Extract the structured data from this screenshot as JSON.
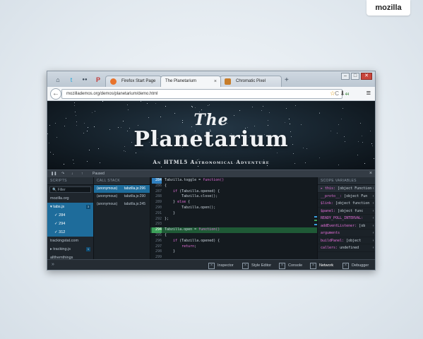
{
  "brand": "mozilla",
  "window_controls": {
    "minimize": "–",
    "maximize": "□",
    "close": "✕"
  },
  "pinned_tabs": [
    {
      "icon": "home-icon",
      "glyph": "⌂"
    },
    {
      "icon": "twitter-icon",
      "glyph": "t"
    },
    {
      "icon": "flickr-icon",
      "glyph": "●●"
    },
    {
      "icon": "pocket-icon",
      "glyph": "P"
    }
  ],
  "tabs": [
    {
      "label": "Firefox Start Page",
      "color": "#e8732c",
      "active": false
    },
    {
      "label": "The Planetarium",
      "color": "#2b3f57",
      "active": true
    },
    {
      "label": "Chromatic Pixel",
      "color": "#c77d2a",
      "active": false
    }
  ],
  "new_tab": "+",
  "nav": {
    "back": "←",
    "url": "mozillademos.org/demos/planetarium/demo.html",
    "reload": "C",
    "bookmark_star": "☆",
    "download_count": "44",
    "menu": "≡"
  },
  "hero": {
    "the": "The",
    "title": "Planetarium",
    "subtitle": "An HTML5 Astronomical Adventure"
  },
  "devtools": {
    "status": "Paused",
    "close": "×",
    "scripts": {
      "header": "Scripts",
      "filter_placeholder": "Filter",
      "items": [
        {
          "label": "mozilla.org",
          "selected": false,
          "sub": false,
          "badge": ""
        },
        {
          "label": "▾ tabs.js",
          "selected": true,
          "sub": false,
          "badge": "3"
        },
        {
          "label": "✓ 284",
          "selected": true,
          "sub": true,
          "badge": ""
        },
        {
          "label": "✓ 294",
          "selected": true,
          "sub": true,
          "badge": ""
        },
        {
          "label": "✓ 312",
          "selected": true,
          "sub": true,
          "badge": ""
        },
        {
          "label": "trackingstat.com",
          "selected": false,
          "sub": false,
          "badge": ""
        },
        {
          "label": "▸ tracking.js",
          "selected": false,
          "sub": false,
          "badge": "1"
        },
        {
          "label": "allthemthings",
          "selected": false,
          "sub": false,
          "badge": ""
        }
      ]
    },
    "callstack": {
      "header": "Call Stack",
      "frames": [
        {
          "fn": "(anonymous)",
          "loc": "tabzilla.js:296",
          "selected": true
        },
        {
          "fn": "(anonymous)",
          "loc": "tabzilla.js:290",
          "selected": false
        },
        {
          "fn": "(anonymous)",
          "loc": "tabzilla.js:245",
          "selected": false
        }
      ]
    },
    "code_lines": [
      {
        "n": "284",
        "text": "Tabzilla.toggle = function()",
        "state": "bp"
      },
      {
        "n": "286",
        "text": "{",
        "state": ""
      },
      {
        "n": "287",
        "text": "    if (Tabzilla.opened) {",
        "state": ""
      },
      {
        "n": "288",
        "text": "        Tabzilla.close();",
        "state": ""
      },
      {
        "n": "289",
        "text": "    } else {",
        "state": ""
      },
      {
        "n": "290",
        "text": "        Tabzilla.open();",
        "state": ""
      },
      {
        "n": "291",
        "text": "    }",
        "state": ""
      },
      {
        "n": "292",
        "text": "};",
        "state": ""
      },
      {
        "n": "293",
        "text": "",
        "state": ""
      },
      {
        "n": "294",
        "text": "Tabzilla.open = function()",
        "state": "hit"
      },
      {
        "n": "295",
        "text": "{",
        "state": ""
      },
      {
        "n": "296",
        "text": "    if (Tabzilla.opened) {",
        "state": ""
      },
      {
        "n": "297",
        "text": "        return;",
        "state": ""
      },
      {
        "n": "298",
        "text": "    }",
        "state": ""
      },
      {
        "n": "299",
        "text": "",
        "state": ""
      },
      {
        "n": "300",
        "text": "    if (Tabzilla.hasCSSTransitions) {",
        "state": ""
      }
    ],
    "scope": {
      "header": "Scope Variables",
      "rows": [
        {
          "key": "▸ this:",
          "val": " [object Function",
          "first": true
        },
        {
          "key": "__proto__:",
          "val": " [object Fun",
          "first": false
        },
        {
          "key": "$link:",
          "val": " [object function",
          "first": false
        },
        {
          "key": "$panel:",
          "val": " [object func",
          "first": false
        },
        {
          "key": "READY_POLL_INTERVAL:",
          "val": "",
          "first": false
        },
        {
          "key": "addEventListener:",
          "val": " [ob",
          "first": false
        },
        {
          "key": "arguments",
          "val": "",
          "first": false
        },
        {
          "key": "buildPanel:",
          "val": " [object",
          "first": false
        },
        {
          "key": "callers:",
          "val": " undefined",
          "first": false
        }
      ]
    },
    "tools": [
      {
        "label": "Inspector",
        "icon": "inspector-icon",
        "active": false
      },
      {
        "label": "Style Editor",
        "icon": "style-editor-icon",
        "active": false
      },
      {
        "label": "Console",
        "icon": "console-icon",
        "active": false
      },
      {
        "label": "Network",
        "icon": "network-icon",
        "active": true
      },
      {
        "label": "Debugger",
        "icon": "debugger-icon",
        "active": false
      }
    ]
  }
}
